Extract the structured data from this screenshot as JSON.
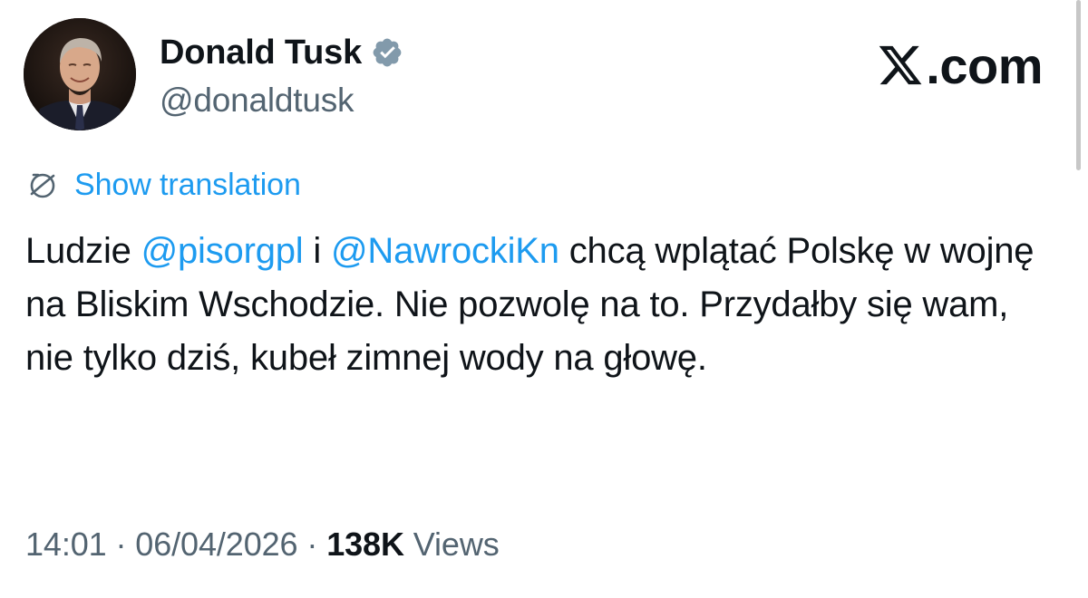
{
  "brand": {
    "logo_icon": "x-logo-icon",
    "suffix": ".com"
  },
  "author": {
    "display_name": "Donald Tusk",
    "handle": "@donaldtusk",
    "verified": true,
    "verified_color": "#829aab",
    "avatar_icon": "profile-avatar"
  },
  "translation": {
    "icon": "globe-icon",
    "label": "Show translation"
  },
  "tweet": {
    "segments": [
      {
        "text": "Ludzie ",
        "type": "text"
      },
      {
        "text": "@pisorgpl",
        "type": "mention"
      },
      {
        "text": " i ",
        "type": "text"
      },
      {
        "text": "@NawrockiKn",
        "type": "mention"
      },
      {
        "text": " chcą wplątać Polskę w wojnę na Bliskim Wschodzie. Nie pozwolę na to. Przydałby się wam, nie tylko dziś, kubeł zimnej wody na głowę.",
        "type": "text"
      }
    ]
  },
  "meta": {
    "time": "14:01",
    "separator": " · ",
    "date": "06/04/2026",
    "views_count": "138K",
    "views_label": "Views"
  },
  "colors": {
    "text": "#0f1419",
    "secondary": "#536471",
    "link": "#1d9bf0"
  }
}
